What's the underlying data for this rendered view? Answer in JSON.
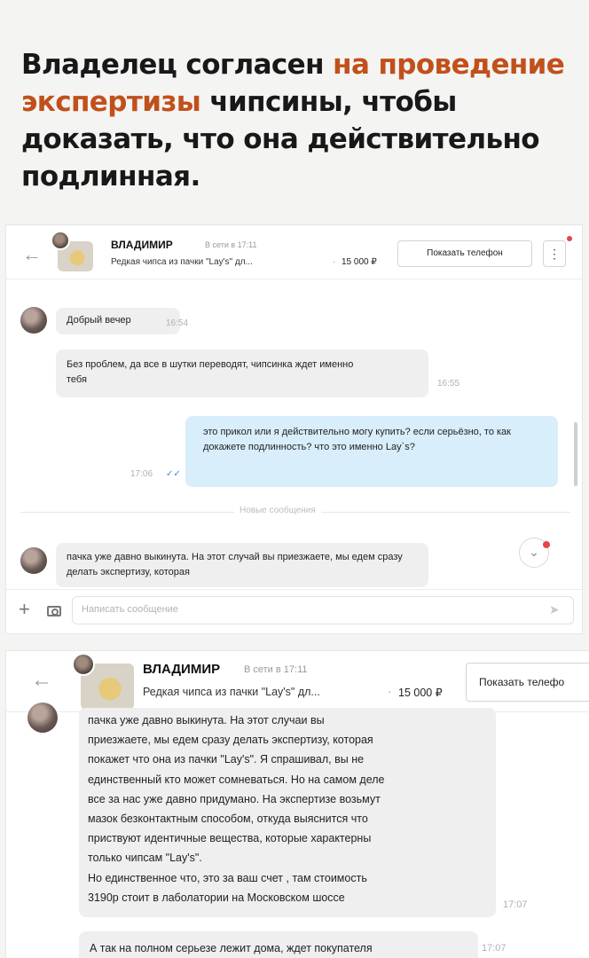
{
  "headline": {
    "part1": "Владелец согласен ",
    "accent": "на проведение экспертизы",
    "part2": " чипсины, чтобы доказать, что она действительно подлинная.",
    "accent_color": "#c1501a"
  },
  "chat1": {
    "header": {
      "contact_name": "ВЛАДИМИР",
      "status": "В сети в 17:11",
      "item_title": "Редкая чипса из пачки \"Lay's\" дл...",
      "price_sep": "·",
      "price": "15 000 ₽",
      "show_phone_label": "Показать телефон",
      "more_icon": "⋮"
    },
    "messages": [
      {
        "text": "Добрый вечер",
        "time": "16:54"
      },
      {
        "text": "Без проблем, да все в шутки переводят, чипсинка ждет именно тебя",
        "time": "16:55"
      },
      {
        "text": "это прикол или я действительно могу купить? если серьёзно, то как докажете подлинность? что это именно Lay`s?",
        "time": "17:06",
        "read_icon": "✓✓"
      },
      {
        "text": "пачка уже давно выкинута. На этот случай вы приезжаете, мы едем сразу делать экспертизу, которая"
      }
    ],
    "new_messages_label": "Новые сообщения",
    "composer": {
      "placeholder": "Написать сообщение",
      "plus_icon": "+",
      "send_icon": "➤"
    },
    "scroll_icon": "⌄"
  },
  "chat2": {
    "header": {
      "contact_name": "ВЛАДИМИР",
      "status": "В сети в 17:11",
      "item_title": "Редкая чипса из пачки \"Lay's\" дл...",
      "price_sep": "·",
      "price": "15 000 ₽",
      "show_phone_label": "Показать телефо"
    },
    "messages": [
      {
        "lines": [
          "пачка уже давно выкинута. На этот случаи вы",
          "приезжаете, мы едем сразу делать экспертизу, которая",
          "покажет что она из пачки \"Lay's\". Я спрашивал, вы не",
          "единственный кто может сомневаться. Но на самом деле",
          "все за нас уже давно придумано. На экспертизе возьмут",
          "мазок безконтактным способом, откуда выяснится что",
          "приствуют идентичные вещества, которые характерны",
          "только чипсам \"Lay's\".",
          "Но единственное что, это за ваш счет , там стоимость",
          "3190р стоит в лаболатории на Московском шоссе"
        ],
        "time": "17:07"
      },
      {
        "text": "А так на полном серьезе лежит дома, ждет покупателя",
        "time": "17:07"
      }
    ]
  }
}
